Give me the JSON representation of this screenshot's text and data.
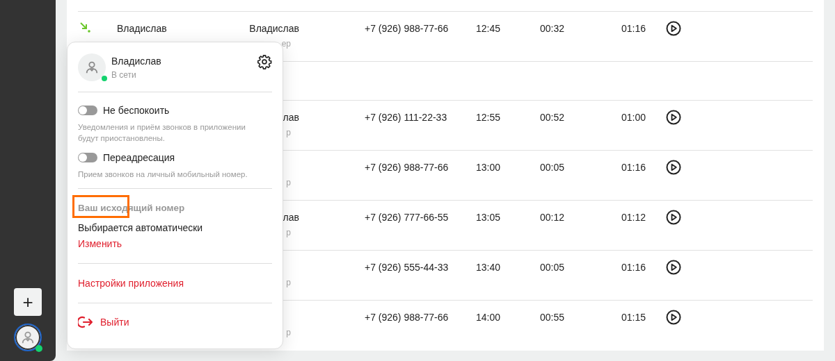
{
  "sidebar": {
    "add_button": "+",
    "user_online": true
  },
  "calls": [
    {
      "kind": "incoming_call",
      "name": "Владислав",
      "contact": "Владислав",
      "contact_note": "ер",
      "phone": "+7 (926) 988-77-66",
      "time": "12:45",
      "duration": "00:32",
      "total": "01:16"
    },
    {
      "kind": "separator"
    },
    {
      "kind": "call",
      "contact": "лав",
      "contact_note": "р",
      "phone": "+7 (926) 111-22-33",
      "time": "12:55",
      "duration": "00:52",
      "total": "01:00"
    },
    {
      "kind": "call",
      "contact_note": "р",
      "phone": "+7 (926) 988-77-66",
      "time": "13:00",
      "duration": "00:05",
      "total": "01:16"
    },
    {
      "kind": "call",
      "contact": "лав",
      "contact_note": "р",
      "phone": "+7 (926) 777-66-55",
      "time": "13:05",
      "duration": "00:12",
      "total": "01:12"
    },
    {
      "kind": "call",
      "contact_note": "р",
      "phone": "+7 (926) 555-44-33",
      "time": "13:40",
      "duration": "00:05",
      "total": "01:16"
    },
    {
      "kind": "call",
      "contact_note": "р",
      "phone": "+7 (926) 988-77-66",
      "time": "14:00",
      "duration": "00:55",
      "total": "01:15"
    }
  ],
  "profile_menu": {
    "user_name": "Владислав",
    "status": "В сети",
    "online": true,
    "toggles": [
      {
        "label": "Не беспокоить",
        "description": "Уведомления и приём звонков в приложении будут приостановлены.",
        "on": false
      },
      {
        "label": "Переадресация",
        "description": "Прием звонков на личный мобильный номер.",
        "on": false
      }
    ],
    "outgoing_number": {
      "heading": "Ваш исходящий номер",
      "highlighted": true,
      "value": "Выбирается автоматически",
      "change_link": "Изменить"
    },
    "app_settings_link": "Настройки приложения",
    "logout": "Выйти"
  }
}
